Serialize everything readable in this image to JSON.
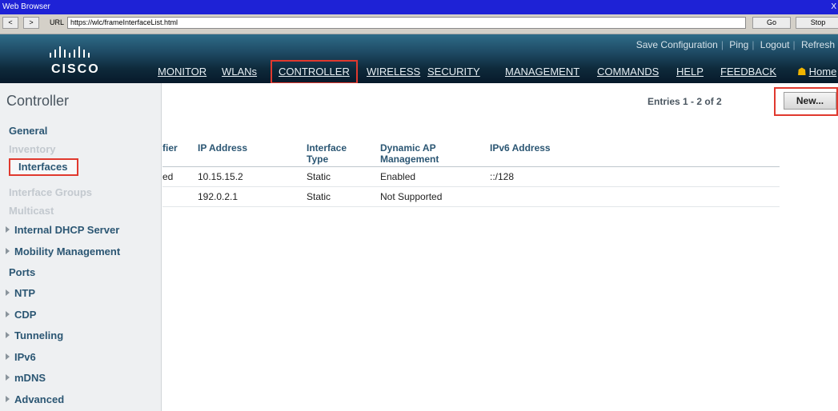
{
  "browser": {
    "title": "Web Browser",
    "close_label": "X",
    "back_label": "<",
    "forward_label": ">",
    "url_label": "URL",
    "url": "https://wlc/frameInterfaceList.html",
    "go_label": "Go",
    "stop_label": "Stop"
  },
  "header": {
    "logo": "CISCO",
    "links": [
      "Save Configuration",
      "Ping",
      "Logout",
      "Refresh"
    ],
    "nav": [
      "MONITOR",
      "WLANs",
      "CONTROLLER",
      "WIRELESS",
      "SECURITY",
      "MANAGEMENT",
      "COMMANDS",
      "HELP",
      "FEEDBACK"
    ],
    "home_label": "Home",
    "active_nav": "CONTROLLER",
    "highlight_color": "#e0392e"
  },
  "sidebar": {
    "title": "Controller",
    "items": [
      {
        "label": "General",
        "arrow": false,
        "dim": false
      },
      {
        "label": "Inventory",
        "arrow": false,
        "dim": true
      },
      {
        "label": "Interfaces",
        "arrow": false,
        "dim": false,
        "selected": true
      },
      {
        "label": "Interface Groups",
        "arrow": false,
        "dim": true
      },
      {
        "label": "Multicast",
        "arrow": false,
        "dim": true
      },
      {
        "label": "Internal DHCP Server",
        "arrow": true,
        "dim": false
      },
      {
        "label": "Mobility Management",
        "arrow": true,
        "dim": false
      },
      {
        "label": "Ports",
        "arrow": false,
        "dim": false
      },
      {
        "label": "NTP",
        "arrow": true,
        "dim": false
      },
      {
        "label": "CDP",
        "arrow": true,
        "dim": false
      },
      {
        "label": "Tunneling",
        "arrow": true,
        "dim": false
      },
      {
        "label": "IPv6",
        "arrow": true,
        "dim": false
      },
      {
        "label": "mDNS",
        "arrow": true,
        "dim": false
      },
      {
        "label": "Advanced",
        "arrow": true,
        "dim": false
      }
    ]
  },
  "main": {
    "entries": "Entries 1 - 2 of 2",
    "new_button": "New...",
    "table": {
      "headers": [
        "fier",
        "IP Address",
        "Interface Type",
        "Dynamic AP Management",
        "IPv6 Address"
      ],
      "header_lines": [
        [
          "",
          "fier"
        ],
        [
          "",
          "IP Address"
        ],
        [
          "Interface",
          "Type"
        ],
        [
          "Dynamic AP",
          "Management"
        ],
        [
          "",
          "IPv6 Address"
        ]
      ],
      "rows": [
        [
          "ed",
          "10.15.15.2",
          "Static",
          "Enabled",
          "::/128"
        ],
        [
          "",
          "192.0.2.1",
          "Static",
          "Not Supported",
          ""
        ]
      ]
    }
  }
}
